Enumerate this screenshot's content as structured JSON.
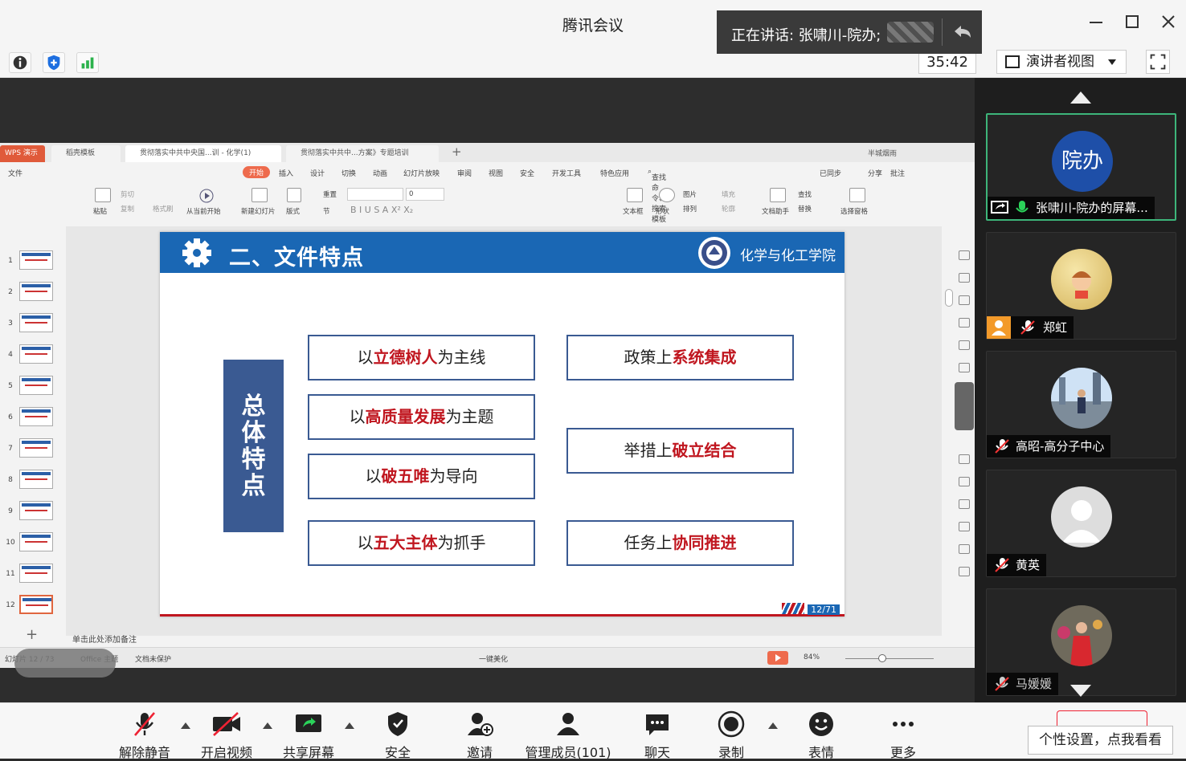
{
  "app": {
    "title": "腾讯会议",
    "speaking": "正在讲话: 张啸川-院办;"
  },
  "topbar": {
    "timer": "35:42",
    "view_label": "演讲者视图"
  },
  "wps": {
    "tabs": [
      "WPS 演示",
      "稻壳模板",
      "贯彻落实中共中央国...训 - 化学(1)",
      "贯彻落实中共中...方案》专题培训"
    ],
    "account": "半城烟雨",
    "menu": [
      "文件",
      "开始",
      "插入",
      "设计",
      "切换",
      "动画",
      "幻灯片放映",
      "审阅",
      "视图",
      "安全",
      "开发工具",
      "特色应用"
    ],
    "search": "查找命令、搜索模板",
    "right_menu": [
      "已同步",
      "分享",
      "批注"
    ],
    "ribbon": {
      "paste": "粘贴",
      "cut": "剪切",
      "copy": "复制",
      "format_painter": "格式刷",
      "from_current": "从当前开始",
      "new_slide": "新建幻灯片",
      "layout": "版式",
      "section": "节",
      "reset": "重置",
      "font_size": "0",
      "textbox": "文本框",
      "shape": "形状",
      "picture": "图片",
      "fill": "填充",
      "arrange": "排列",
      "outline": "轮廓",
      "doc_assistant": "文档助手",
      "find": "查找",
      "replace": "替换",
      "select_pane": "选择窗格"
    },
    "thumbnails": [
      "1",
      "2",
      "3",
      "4",
      "5",
      "6",
      "7",
      "8",
      "9",
      "10",
      "11",
      "12"
    ],
    "notes_placeholder": "单击此处添加备注",
    "status": {
      "slide_info": "幻灯片 12 / 73",
      "theme": "Office 主题",
      "protect": "文档未保护",
      "beautify": "一键美化",
      "zoom": "84%"
    }
  },
  "slide": {
    "title": "二、文件特点",
    "school": "化学与化工学院",
    "vertical_label": [
      "总",
      "体",
      "特",
      "点"
    ],
    "left_boxes": [
      {
        "pre": "以",
        "em": "立德树人",
        "post": "为主线"
      },
      {
        "pre": "以",
        "em": "高质量发展",
        "post": "为主题"
      },
      {
        "pre": "以",
        "em": "破五唯",
        "post": "为导向"
      },
      {
        "pre": "以",
        "em": "五大主体",
        "post": "为抓手"
      }
    ],
    "right_boxes": [
      {
        "pre": "政策上",
        "em": "系统集成",
        "post": ""
      },
      {
        "pre": "举措上",
        "em": "破立结合",
        "post": ""
      },
      {
        "pre": "任务上",
        "em": "协同推进",
        "post": ""
      }
    ],
    "page": "12/71"
  },
  "participants": [
    {
      "name": "张啸川-院办的屏幕...",
      "avatar_text": "院办"
    },
    {
      "name": "郑虹"
    },
    {
      "name": "高昭-高分子中心"
    },
    {
      "name": "黄英"
    },
    {
      "name": "马媛媛"
    }
  ],
  "bottom": {
    "unmute": "解除静音",
    "video": "开启视频",
    "share": "共享屏幕",
    "security": "安全",
    "invite": "邀请",
    "members": "管理成员(101)",
    "chat": "聊天",
    "record": "录制",
    "reaction": "表情",
    "more": "更多",
    "tip": "个性设置，点我看看"
  },
  "colors": {
    "slide_blue": "#1a67b4",
    "box_border": "#3a5a92",
    "emphasis_red": "#c0161f",
    "accent_green": "#3db57a"
  }
}
